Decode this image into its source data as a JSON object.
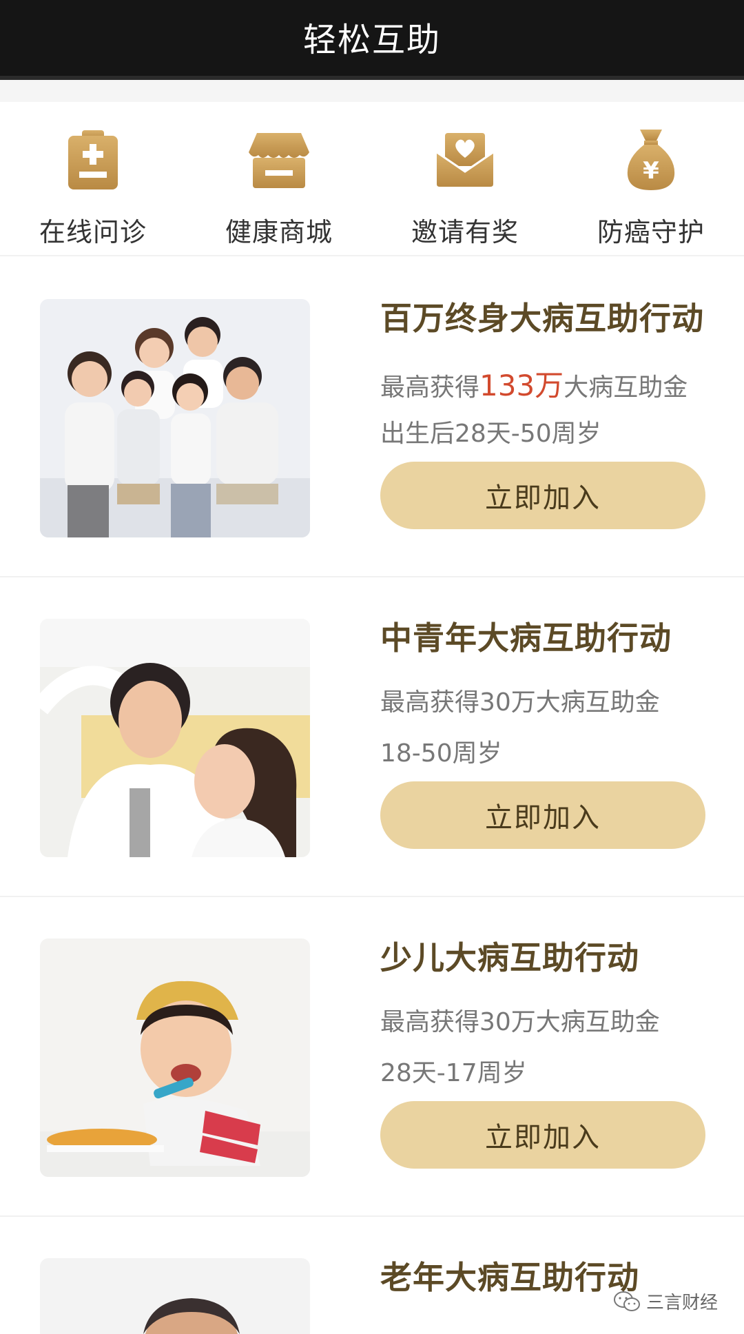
{
  "header": {
    "title": "轻松互助"
  },
  "quicknav": [
    {
      "label": "在线问诊",
      "icon": "medical-clipboard-icon"
    },
    {
      "label": "健康商城",
      "icon": "shop-icon"
    },
    {
      "label": "邀请有奖",
      "icon": "heart-envelope-icon"
    },
    {
      "label": "防癌守护",
      "icon": "money-bag-icon"
    }
  ],
  "cards": [
    {
      "title": "百万终身大病互助行动",
      "line1_prefix": "最高获得",
      "line1_highlight": "133万",
      "line1_suffix": "大病互助金",
      "line2": "出生后28天-50周岁",
      "button": "立即加入",
      "photo": "family-photo"
    },
    {
      "title": "中青年大病互助行动",
      "line1_prefix": "最高获得30万大病互助金",
      "line2": "18-50周岁",
      "button": "立即加入",
      "photo": "couple-photo"
    },
    {
      "title": "少儿大病互助行动",
      "line1_prefix": "最高获得30万大病互助金",
      "line2": "28天-17周岁",
      "button": "立即加入",
      "photo": "child-photo"
    },
    {
      "title": "老年大病互助行动",
      "photo": "elderly-photo"
    }
  ],
  "watermark": {
    "text": "三言财经"
  },
  "colors": {
    "header_bg": "#151515",
    "accent_gold": "#c79a52",
    "button_bg": "#ead3a0",
    "highlight_red": "#d24a2e",
    "title_brown": "#5c4a26"
  }
}
